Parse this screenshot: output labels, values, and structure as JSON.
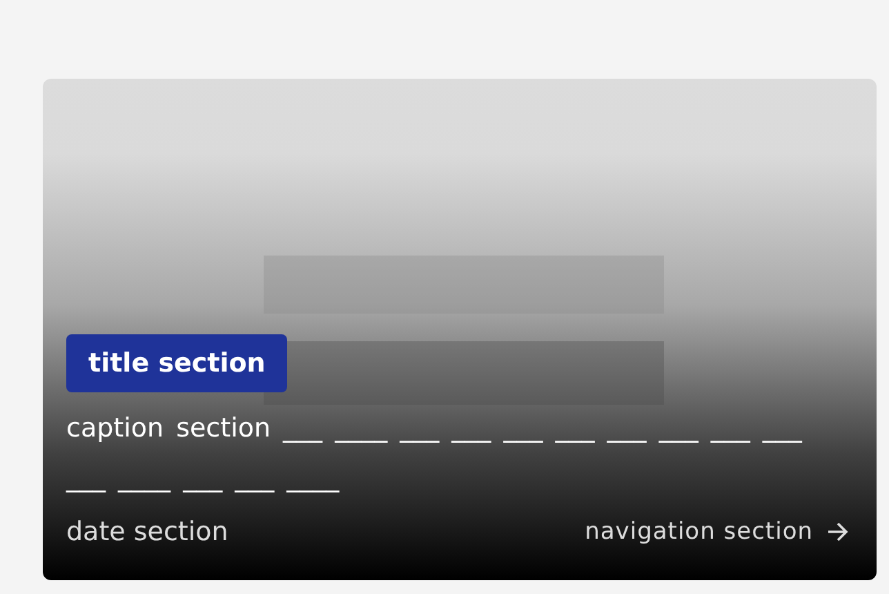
{
  "card": {
    "title": "title section",
    "caption": "caption section ___ ____ ___ ___ ___ ___ ___ ___ ___ ___ ___ ____ ___ ___ ____",
    "date": "date section",
    "navigation": {
      "label": "navigation section"
    }
  }
}
